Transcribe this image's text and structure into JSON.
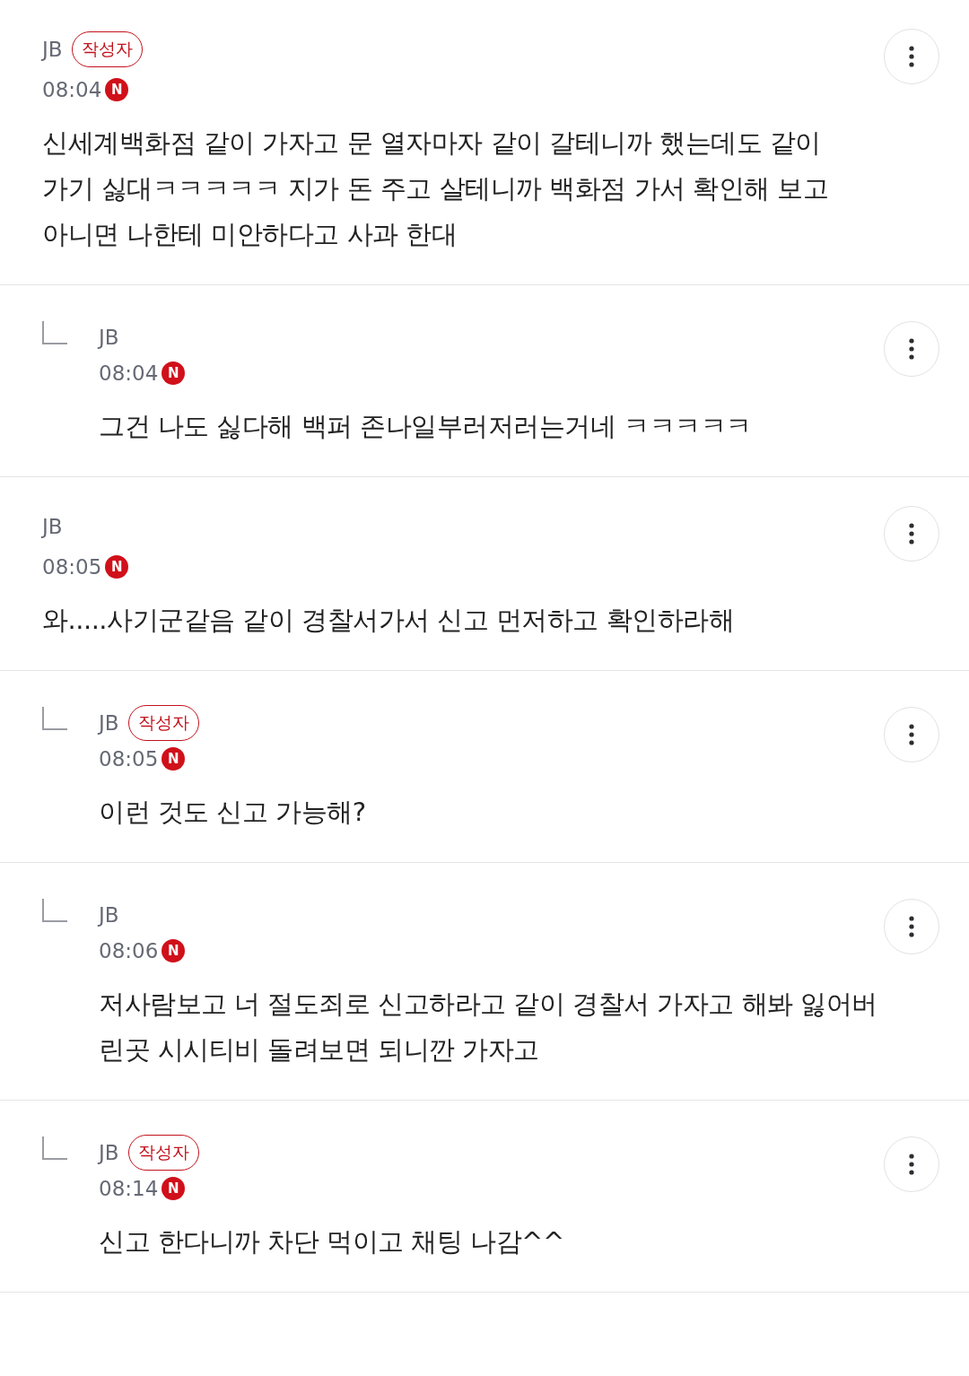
{
  "comments": [
    {
      "kind": "comment",
      "author": "JB",
      "badge": "작성자",
      "time": "08:04",
      "new_mark": "N",
      "text": "신세계백화점 같이 가자고 문 열자마자 같이 갈테니까 했는데도 같이 가기 싫대ㅋㅋㅋㅋㅋ 지가 돈 주고 살테니까 백화점 가서 확인해 보고 아니면 나한테 미안하다고 사과 한대"
    },
    {
      "kind": "reply",
      "author": "JB",
      "time": "08:04",
      "new_mark": "N",
      "text": "그건 나도 싫다해 백퍼 존나일부러저러는거네 ㅋㅋㅋㅋㅋ"
    },
    {
      "kind": "comment",
      "author": "JB",
      "time": "08:05",
      "new_mark": "N",
      "text": "와.....사기군같음 같이 경찰서가서 신고 먼저하고 확인하라해"
    },
    {
      "kind": "reply",
      "author": "JB",
      "badge": "작성자",
      "time": "08:05",
      "new_mark": "N",
      "text": "이런 것도 신고 가능해?"
    },
    {
      "kind": "reply",
      "author": "JB",
      "time": "08:06",
      "new_mark": "N",
      "text": "저사람보고 너 절도죄로 신고하라고 같이 경찰서 가자고 해봐 잃어버린곳 시시티비 돌려보면 되니깐 가자고"
    },
    {
      "kind": "reply",
      "author": "JB",
      "badge": "작성자",
      "time": "08:14",
      "new_mark": "N",
      "text": "신고 한다니까 차단 먹이고 채팅 나감^^"
    }
  ]
}
